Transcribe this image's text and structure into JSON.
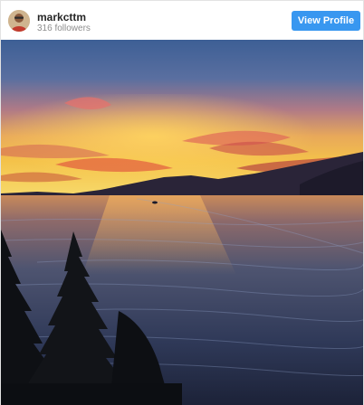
{
  "profile": {
    "username": "markcttm",
    "followers": "316 followers",
    "view_profile_label": "View Profile",
    "avatar_icon": "user-avatar-photo"
  },
  "post": {
    "image_icon": "sunset-over-water-photo"
  },
  "colors": {
    "button": "#3897f0",
    "username": "#262626",
    "subtext": "#8e8e8e"
  }
}
